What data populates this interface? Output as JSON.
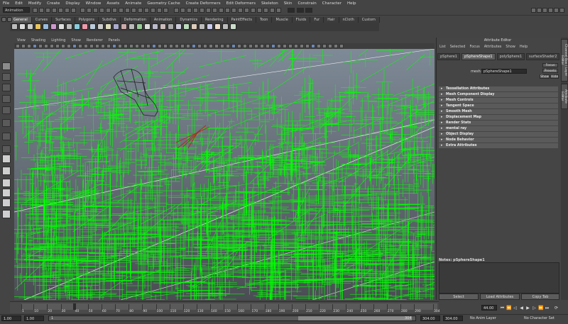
{
  "menubar": {
    "items": [
      "File",
      "Edit",
      "Modify",
      "Create",
      "Display",
      "Window",
      "Assets",
      "Animate",
      "Geometry Cache",
      "Create Deformers",
      "Edit Deformers",
      "Skeleton",
      "Skin",
      "Constrain",
      "Character",
      "Help"
    ]
  },
  "statusline": {
    "mode": "Animation"
  },
  "shelf": {
    "tabs": [
      "General",
      "Curves",
      "Surfaces",
      "Polygons",
      "Subdivs",
      "Deformation",
      "Animation",
      "Dynamics",
      "Rendering",
      "PaintEffects",
      "Toon",
      "Muscle",
      "Fluids",
      "Fur",
      "Hair",
      "nCloth",
      "Custom"
    ],
    "active_tab": "General"
  },
  "viewport": {
    "menu": [
      "View",
      "Shading",
      "Lighting",
      "Show",
      "Renderer",
      "Panels"
    ],
    "wire_color": "#00ff00",
    "background_top": "#7e8a97",
    "background_bottom": "#4a4d53"
  },
  "attribute_editor": {
    "title": "Attribute Editor",
    "menu": [
      "List",
      "Selected",
      "Focus",
      "Attributes",
      "Show",
      "Help"
    ],
    "tabs": [
      "pSphere1",
      "pSphereShape1",
      "polySphere1",
      "surfaceShader2"
    ],
    "active_tab": "pSphereShape1",
    "mesh_label": "mesh:",
    "mesh_value": "pSphereShape1",
    "focus_button": "Focus",
    "presets_button": "Presets",
    "show_button": "Show",
    "hide_button": "Hide",
    "sections": [
      "Tessellation Attributes",
      "Mesh Component Display",
      "Mesh Controls",
      "Tangent Space",
      "Smooth Mesh",
      "Displacement Map",
      "Render Stats",
      "mental ray",
      "Object Display",
      "Node Behavior",
      "Extra Attributes"
    ],
    "notes_label": "Notes: pSphereShape1",
    "select_button": "Select",
    "load_attributes_button": "Load Attributes",
    "copy_tab_button": "Copy Tab"
  },
  "right_tabs": [
    "Channel Box / Layer Editor",
    "Attribute Editor"
  ],
  "timeslider": {
    "ticks": [
      "1",
      "10",
      "20",
      "30",
      "40",
      "50",
      "60",
      "70",
      "80",
      "90",
      "100",
      "110",
      "120",
      "130",
      "140",
      "150",
      "160",
      "170",
      "180",
      "190",
      "200",
      "210",
      "220",
      "230",
      "240",
      "250",
      "260",
      "270",
      "280",
      "290",
      "304"
    ],
    "current_frame": "44.00"
  },
  "range": {
    "start": "1.00",
    "start2": "1.00",
    "range_mark_1": "1",
    "range_mark_2": "304",
    "end": "304.00",
    "end2": "304.00",
    "anim_layer": "No Anim Layer",
    "character_set": "No Character Set"
  }
}
